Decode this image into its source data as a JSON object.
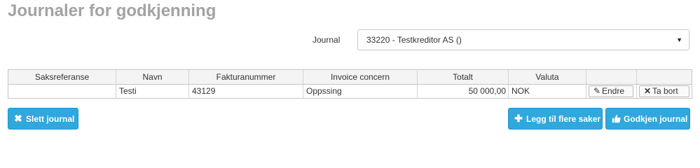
{
  "page": {
    "title": "Journaler for godkjenning"
  },
  "journal": {
    "label": "Journal",
    "selected": "33220 - Testkreditor AS ()"
  },
  "table": {
    "headers": [
      "Saksreferanse",
      "Navn",
      "Fakturanummer",
      "Invoice concern",
      "Totalt",
      "Valuta",
      "",
      ""
    ],
    "rows": [
      {
        "saksreferanse": "",
        "navn": "Testi",
        "fakturanummer": "43129",
        "invoice_concern": "Oppssing",
        "totalt": "50 000,00",
        "valuta": "NOK",
        "edit_label": "Endre",
        "remove_label": "Ta bort"
      }
    ]
  },
  "actions": {
    "delete_journal": "Slett journal",
    "add_more_cases": "Legg til flere saker",
    "approve_journal": "Godkjen journal"
  },
  "icons": {
    "pencil": "pencil-icon",
    "remove": "x-icon",
    "plus": "plus-icon",
    "thumbs_up": "thumbs-up-icon"
  },
  "colors": {
    "primary": "#30a8dd",
    "title": "#a3a3a3"
  }
}
